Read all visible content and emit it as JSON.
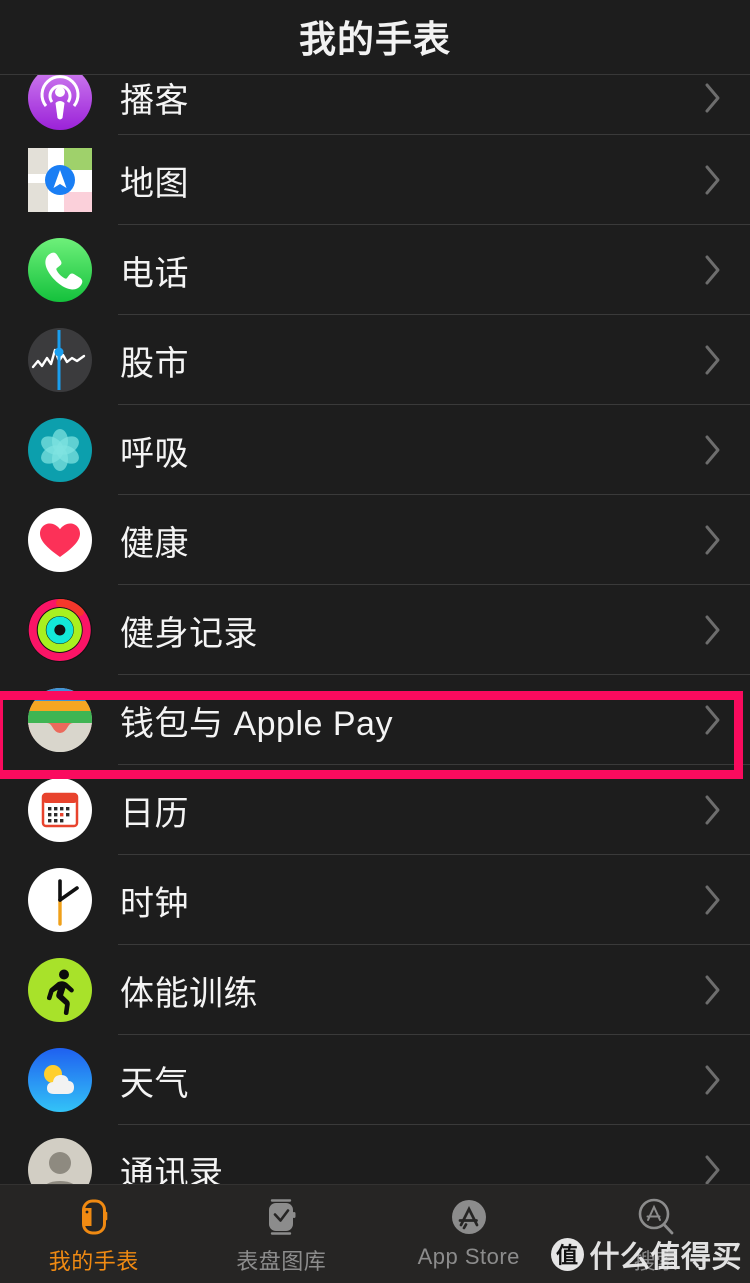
{
  "header": {
    "title": "我的手表"
  },
  "list": {
    "rows": [
      {
        "label": "播客",
        "icon": "podcasts-icon",
        "partial_top": true
      },
      {
        "label": "地图",
        "icon": "maps-icon"
      },
      {
        "label": "电话",
        "icon": "phone-icon"
      },
      {
        "label": "股市",
        "icon": "stocks-icon"
      },
      {
        "label": "呼吸",
        "icon": "breathe-icon"
      },
      {
        "label": "健康",
        "icon": "health-icon"
      },
      {
        "label": "健身记录",
        "icon": "activity-icon"
      },
      {
        "label": "钱包与 Apple Pay",
        "icon": "wallet-icon",
        "highlighted": true
      },
      {
        "label": "日历",
        "icon": "calendar-icon"
      },
      {
        "label": "时钟",
        "icon": "clock-icon"
      },
      {
        "label": "体能训练",
        "icon": "workout-icon"
      },
      {
        "label": "天气",
        "icon": "weather-icon"
      },
      {
        "label": "通讯录",
        "icon": "contacts-icon",
        "partial_bottom": true
      }
    ],
    "chevron_icon": "chevron-right-icon"
  },
  "highlight": {
    "color": "#fa0b5e",
    "target_label": "钱包与 Apple Pay"
  },
  "tabbar": {
    "tabs": [
      {
        "label": "我的手表",
        "icon": "watch-icon",
        "active": true
      },
      {
        "label": "表盘图库",
        "icon": "watch-face-icon",
        "active": false
      },
      {
        "label": "App Store",
        "icon": "app-store-icon",
        "active": false
      },
      {
        "label": "搜索",
        "icon": "search-a-icon",
        "active": false
      }
    ],
    "active_color": "#f08a12",
    "inactive_color": "#8c8c8c"
  },
  "watermark": {
    "badge": "值",
    "text": "什么值得买"
  },
  "colors": {
    "background": "#1d1d1d",
    "divider": "#3a3a3a",
    "text": "#f4f4f4",
    "tabbar_background": "#262524"
  }
}
